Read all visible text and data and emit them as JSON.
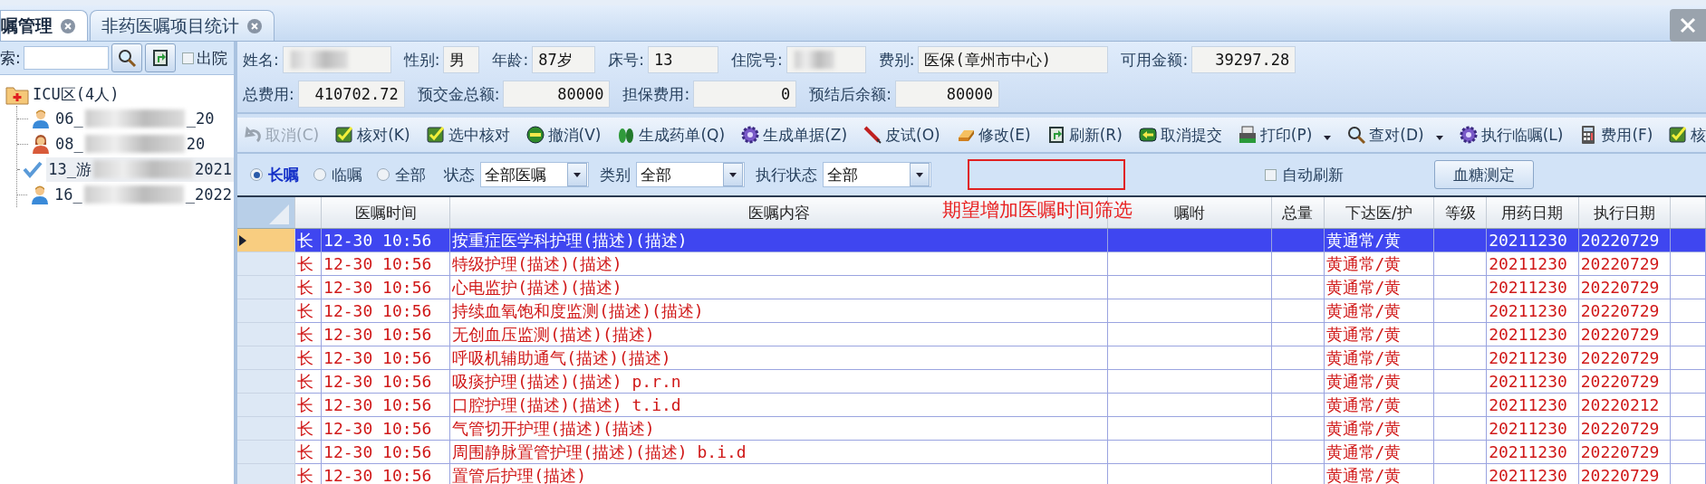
{
  "tabs": [
    {
      "label": "嘱管理",
      "selected": true
    },
    {
      "label": "非药医嘱项目统计",
      "selected": false
    }
  ],
  "sidebar": {
    "search_label": "索:",
    "discharged_label": "出院",
    "discharged_checked": false,
    "tree": {
      "label": "ICU区(4人)",
      "children": [
        {
          "kind": "man",
          "label_start": "06_",
          "label_end": "_20",
          "selected": false
        },
        {
          "kind": "woman",
          "label_start": "08_",
          "label_end": "20",
          "selected": false
        },
        {
          "kind": "check",
          "label_start": "13_游",
          "label_end": "2021",
          "selected": true
        },
        {
          "kind": "man",
          "label_start": "16_",
          "label_end": "_2022",
          "selected": false
        }
      ]
    }
  },
  "patient_info": [
    [
      {
        "label": "姓名:",
        "redacted": true
      },
      {
        "label": "性别:",
        "value": "男",
        "kind": "text"
      },
      {
        "label": "年龄:",
        "value": "87岁",
        "kind": "text"
      },
      {
        "label": "床号:",
        "value": "13",
        "kind": "text"
      },
      {
        "label": "住院号:",
        "redacted": true
      },
      {
        "label": "费别:",
        "value": "医保(章州市中心)",
        "kind": "text"
      },
      {
        "label": "可用金额:",
        "value": "39297.28",
        "kind": "amount"
      }
    ],
    [
      {
        "label": "总费用:",
        "value": "410702.72",
        "kind": "amount"
      },
      {
        "label": "预交金总额:",
        "value": "80000",
        "kind": "amount"
      },
      {
        "label": "担保费用:",
        "value": "0",
        "kind": "amount"
      },
      {
        "label": "预结后余额:",
        "value": "80000",
        "kind": "amount"
      }
    ]
  ],
  "toolbar": [
    {
      "label": "取消(C)",
      "kind": "undo",
      "disabled": true
    },
    {
      "label": "核对(K)",
      "kind": "check",
      "disabled": false
    },
    {
      "label": "选中核对",
      "kind": "check",
      "disabled": false
    },
    {
      "label": "撤消(V)",
      "kind": "minus",
      "disabled": false
    },
    {
      "label": "生成药单(Q)",
      "kind": "leaves",
      "disabled": false
    },
    {
      "label": "生成单据(Z)",
      "kind": "gear",
      "disabled": false
    },
    {
      "label": "皮试(O)",
      "kind": "pen",
      "disabled": false
    },
    {
      "label": "修改(E)",
      "kind": "eraser",
      "disabled": false
    },
    {
      "label": "刷新(R)",
      "kind": "door",
      "disabled": false
    },
    {
      "label": "取消提交",
      "kind": "back",
      "disabled": false
    },
    {
      "label": "打印(P)",
      "kind": "printer",
      "disabled": false,
      "dropdown": true
    },
    {
      "label": "查对(D)",
      "kind": "magnifier",
      "disabled": false,
      "dropdown": true
    },
    {
      "label": "执行临嘱(L)",
      "kind": "gear",
      "disabled": false
    },
    {
      "label": "费用(F)",
      "kind": "calculator",
      "disabled": false
    },
    {
      "label": "核",
      "kind": "check",
      "disabled": false
    }
  ],
  "filters": {
    "order_types": [
      {
        "label": "长嘱",
        "selected": true
      },
      {
        "label": "临嘱",
        "selected": false
      },
      {
        "label": "全部",
        "selected": false
      }
    ],
    "dropdowns": [
      {
        "label": "状态",
        "value": "全部医嘱"
      },
      {
        "label": "类别",
        "value": "全部"
      },
      {
        "label": "执行状态",
        "value": "全部"
      }
    ],
    "auto_refresh": {
      "label": "自动刷新",
      "checked": false
    },
    "button": "血糖测定"
  },
  "annotation": "期望增加医嘱时间筛选",
  "table": {
    "columns": [
      "医嘱时间",
      "医嘱内容",
      "嘱咐",
      "总量",
      "下达医/护",
      "等级",
      "用药日期",
      "执行日期"
    ],
    "rows": [
      {
        "type": "长",
        "time": "12-30 10:56",
        "content": "按重症医学科护理(描述)(描述)",
        "doctor": "黄通常/黄",
        "drug_date": "20211230",
        "exec_date": "20220729",
        "selected": true
      },
      {
        "type": "长",
        "time": "12-30 10:56",
        "content": "特级护理(描述)(描述)",
        "doctor": "黄通常/黄",
        "drug_date": "20211230",
        "exec_date": "20220729",
        "selected": false
      },
      {
        "type": "长",
        "time": "12-30 10:56",
        "content": "心电监护(描述)(描述)",
        "doctor": "黄通常/黄",
        "drug_date": "20211230",
        "exec_date": "20220729",
        "selected": false
      },
      {
        "type": "长",
        "time": "12-30 10:56",
        "content": "持续血氧饱和度监测(描述)(描述)",
        "doctor": "黄通常/黄",
        "drug_date": "20211230",
        "exec_date": "20220729",
        "selected": false
      },
      {
        "type": "长",
        "time": "12-30 10:56",
        "content": "无创血压监测(描述)(描述)",
        "doctor": "黄通常/黄",
        "drug_date": "20211230",
        "exec_date": "20220729",
        "selected": false
      },
      {
        "type": "长",
        "time": "12-30 10:56",
        "content": "呼吸机辅助通气(描述)(描述)",
        "doctor": "黄通常/黄",
        "drug_date": "20211230",
        "exec_date": "20220729",
        "selected": false
      },
      {
        "type": "长",
        "time": "12-30 10:56",
        "content": "吸痰护理(描述)(描述) p.r.n",
        "doctor": "黄通常/黄",
        "drug_date": "20211230",
        "exec_date": "20220729",
        "selected": false
      },
      {
        "type": "长",
        "time": "12-30 10:56",
        "content": "口腔护理(描述)(描述) t.i.d",
        "doctor": "黄通常/黄",
        "drug_date": "20211230",
        "exec_date": "20220212",
        "selected": false
      },
      {
        "type": "长",
        "time": "12-30 10:56",
        "content": "气管切开护理(描述)(描述)",
        "doctor": "黄通常/黄",
        "drug_date": "20211230",
        "exec_date": "20220729",
        "selected": false
      },
      {
        "type": "长",
        "time": "12-30 10:56",
        "content": "周围静脉置管护理(描述)(描述) b.i.d",
        "doctor": "黄通常/黄",
        "drug_date": "20211230",
        "exec_date": "20220729",
        "selected": false
      },
      {
        "type": "长",
        "time": "12-30 10:56",
        "content": "置管后护理(描述)",
        "doctor": "黄通常/黄",
        "drug_date": "20211230",
        "exec_date": "20220729",
        "selected": false
      }
    ]
  }
}
